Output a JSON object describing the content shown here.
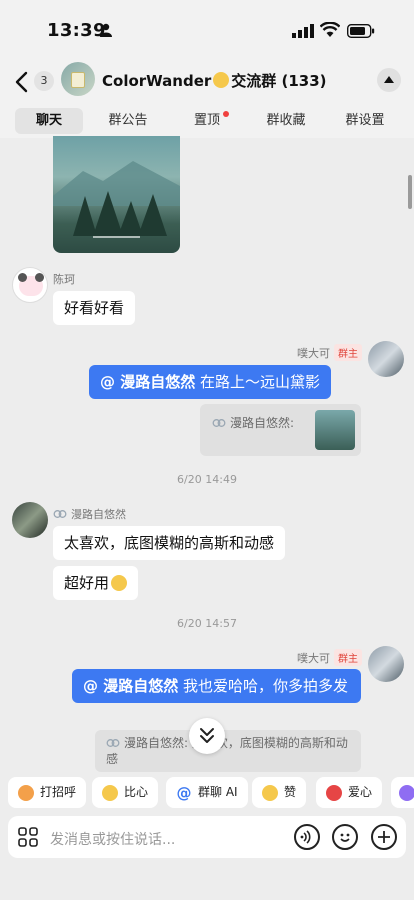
{
  "status": {
    "time": "13:39"
  },
  "header": {
    "back_count": "3",
    "group_name": "ColorWander",
    "group_suffix": "交流群 (133)"
  },
  "tabs": [
    {
      "label": "聊天"
    },
    {
      "label": "群公告"
    },
    {
      "label": "置顶"
    },
    {
      "label": "群收藏"
    },
    {
      "label": "群设置"
    }
  ],
  "messages": {
    "m1_sender": "陈珂",
    "m1_text": "好看好看",
    "m2_sender": "噗大可",
    "m2_role": "群主",
    "m2_mention": "@ 漫路自悠然",
    "m2_text": " 在路上～远山黛影",
    "m2_quote": "漫路自悠然:",
    "time1": "6/20 14:49",
    "m3_sender": "漫路自悠然",
    "m3_text1": "太喜欢，底图模糊的高斯和动感",
    "m3_text2": "超好用",
    "time2": "6/20 14:57",
    "m4_sender": "噗大可",
    "m4_role": "群主",
    "m4_mention": "@ 漫路自悠然",
    "m4_text": " 我也爱哈哈，你多拍多发",
    "m4_quote": "漫路自悠然: 太喜欢，底图模糊的高斯和动感"
  },
  "quick_actions": [
    {
      "label": "打招呼",
      "color": "#f3a04a"
    },
    {
      "label": "比心",
      "color": "#f5c84c"
    },
    {
      "label": "群聊 AI",
      "color": "#3d79f2"
    },
    {
      "label": "赞",
      "color": "#f5c84c"
    },
    {
      "label": "爱心",
      "color": "#e64545"
    }
  ],
  "input": {
    "placeholder": "发消息或按住说话..."
  },
  "colors": {
    "accent_blue": "#3d79f2",
    "owner_red": "#e0443b",
    "background": "#ededed"
  }
}
